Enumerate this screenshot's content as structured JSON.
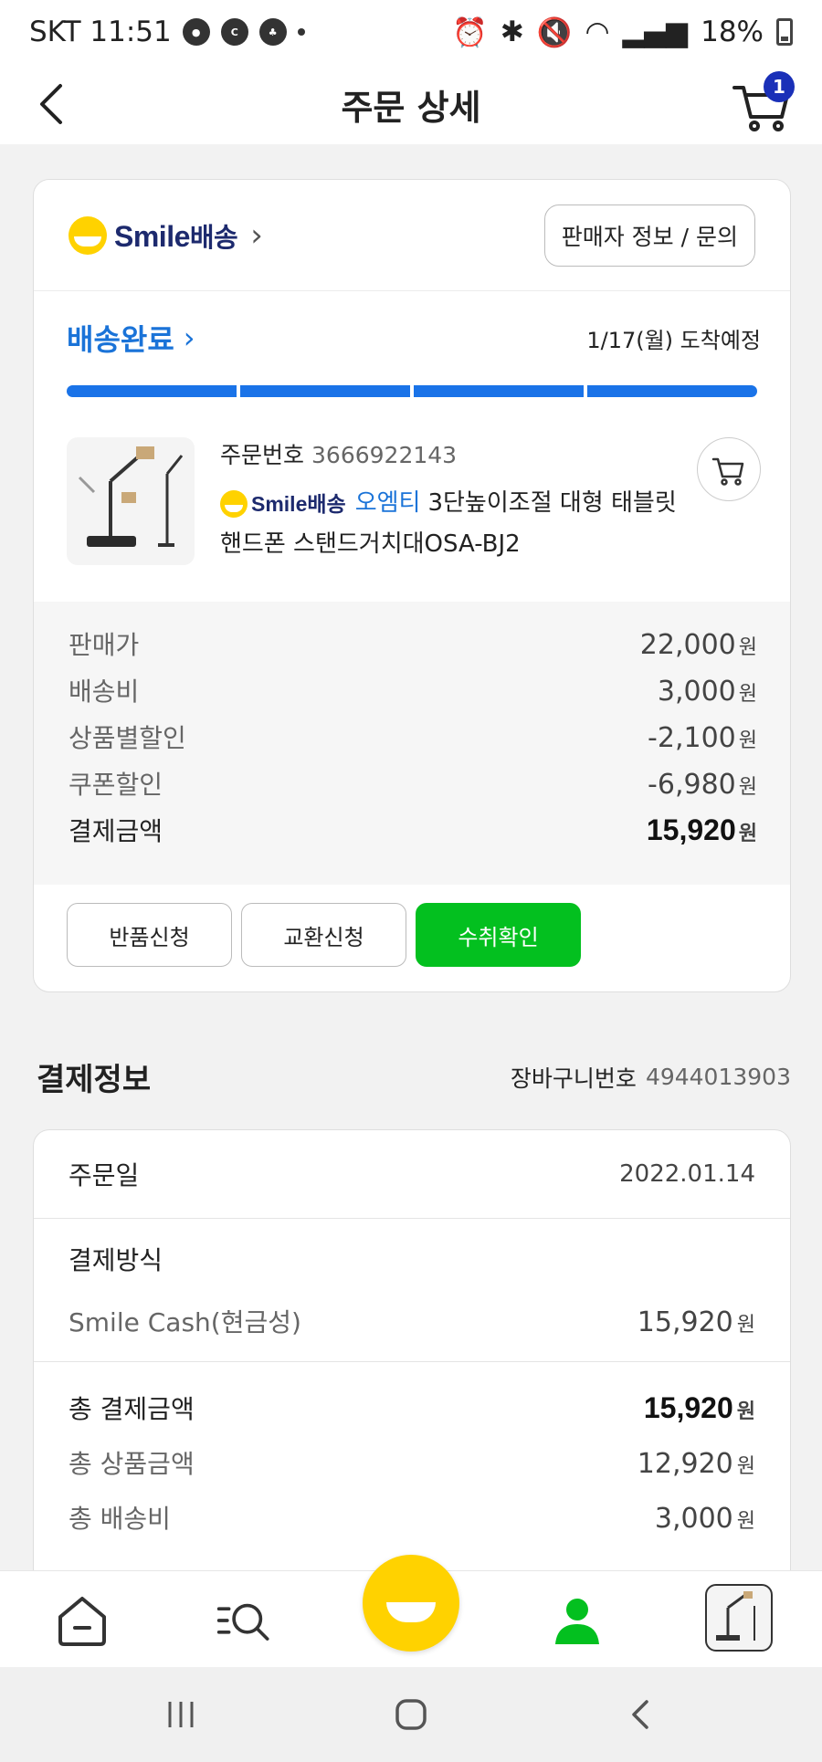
{
  "status_bar": {
    "carrier_time": "SKT 11:51",
    "battery": "18%"
  },
  "header": {
    "title": "주문 상세",
    "cart_count": "1"
  },
  "order": {
    "brand": "Smile",
    "brand_ko": "배송",
    "seller_button": "판매자 정보 / 문의",
    "status": "배송완료",
    "eta": "1/17(월) 도착예정",
    "progress_steps_total": 4,
    "progress_steps_done": 4,
    "order_no_label": "주문번호",
    "order_no": "3666922143",
    "product_brand": "Smile",
    "product_brand_ko": "배송",
    "product_seller": "오엠티",
    "product_title": "3단높이조절 대형 태블릿 핸드폰 스탠드거치대OSA-BJ2",
    "prices": [
      {
        "label": "판매가",
        "value": "22,000",
        "unit": "원"
      },
      {
        "label": "배송비",
        "value": "3,000",
        "unit": "원"
      },
      {
        "label": "상품별할인",
        "value": "-2,100",
        "unit": "원"
      },
      {
        "label": "쿠폰할인",
        "value": "-6,980",
        "unit": "원"
      }
    ],
    "total_label": "결제금액",
    "total_value": "15,920",
    "total_unit": "원",
    "actions": {
      "return": "반품신청",
      "exchange": "교환신청",
      "confirm": "수취확인"
    }
  },
  "payment": {
    "section_title": "결제정보",
    "cart_no_label": "장바구니번호",
    "cart_no": "4944013903",
    "date_label": "주문일",
    "date": "2022.01.14",
    "method_label": "결제방식",
    "method": "Smile Cash(현금성)",
    "method_amount": "15,920",
    "unit": "원",
    "total_label": "총 결제금액",
    "total_value": "15,920",
    "goods_label": "총 상품금액",
    "goods_value": "12,920",
    "shipping_label": "총 배송비",
    "shipping_value": "3,000"
  },
  "colors": {
    "accent_blue": "#1a73e8",
    "confirm_green": "#03c01f",
    "smile_yellow": "#ffd200",
    "brand_navy": "#1d2a6e",
    "badge_blue": "#1a30b8"
  },
  "icons": {
    "back": "chevron-left-icon",
    "cart": "cart-icon",
    "nav": [
      "home-icon",
      "category-search-icon",
      "smile-home-icon",
      "my-page-icon",
      "recent-item-thumbnail"
    ],
    "system": [
      "recents-icon",
      "home-icon",
      "back-icon"
    ]
  }
}
